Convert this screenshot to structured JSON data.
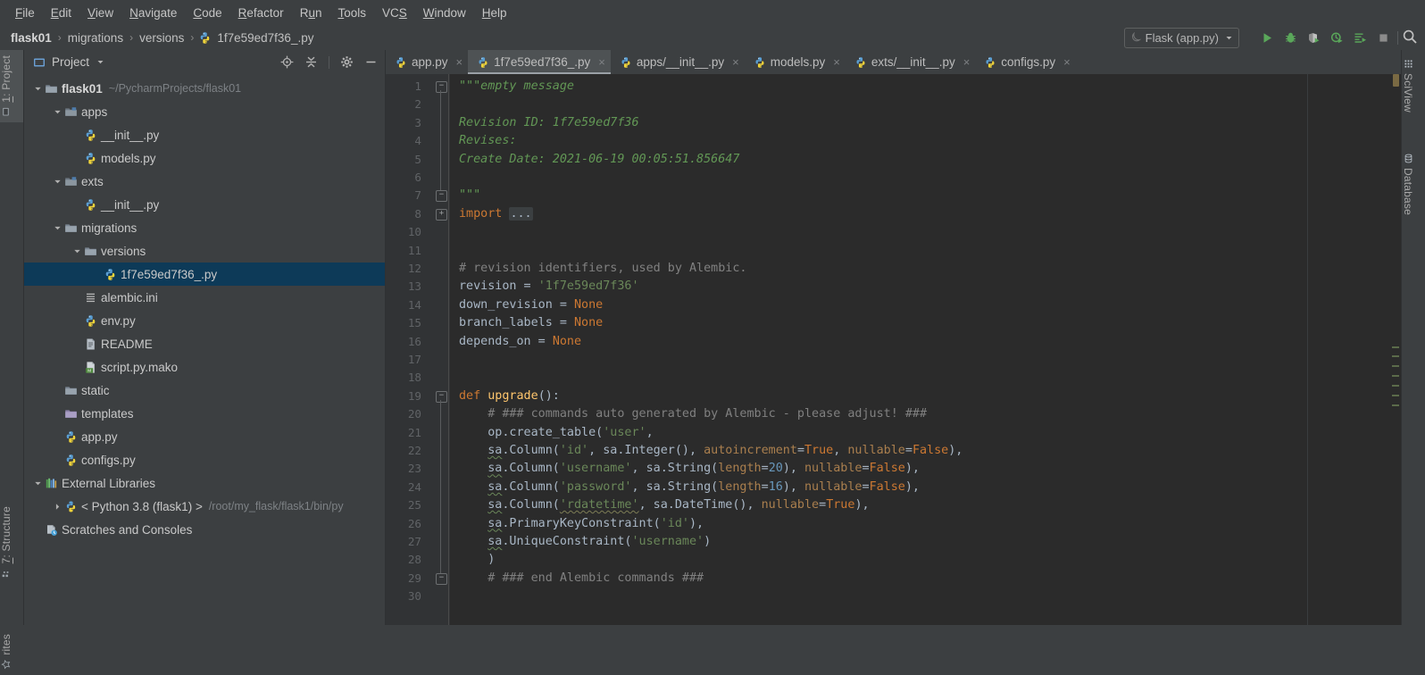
{
  "window": {
    "theme_bg": "#3c3f41",
    "editor_bg": "#2b2b2b",
    "accent_selection": "#0d3a58"
  },
  "menubar": {
    "items": [
      {
        "label": "File",
        "mnemonic": "F"
      },
      {
        "label": "Edit",
        "mnemonic": "E"
      },
      {
        "label": "View",
        "mnemonic": "V"
      },
      {
        "label": "Navigate",
        "mnemonic": "N"
      },
      {
        "label": "Code",
        "mnemonic": "C"
      },
      {
        "label": "Refactor",
        "mnemonic": "R"
      },
      {
        "label": "Run",
        "mnemonic": "u"
      },
      {
        "label": "Tools",
        "mnemonic": "T"
      },
      {
        "label": "VCS",
        "mnemonic": "S"
      },
      {
        "label": "Window",
        "mnemonic": "W"
      },
      {
        "label": "Help",
        "mnemonic": "H"
      }
    ]
  },
  "navbar": {
    "breadcrumb": [
      "flask01",
      "migrations",
      "versions",
      "1f7e59ed7f36_.py"
    ],
    "run_config": {
      "name": "Flask (app.py)",
      "icon": "flask-config-icon",
      "dropdown": "chevron-down-icon"
    },
    "toolbar_icons": [
      "run-icon",
      "debug-icon",
      "run-coverage-icon",
      "profile-icon",
      "run-with-console-icon",
      "stop-icon"
    ],
    "search_icon": "search-icon"
  },
  "left_rail": {
    "tabs": [
      {
        "label": "1: Project",
        "num": "1",
        "icon": "project-tool-icon",
        "selected": true
      },
      {
        "label": "7: Structure",
        "num": "7",
        "icon": "structure-tool-icon",
        "selected": false
      },
      {
        "label": "rites",
        "num": "",
        "icon": "favorites-tool-icon",
        "selected": false
      }
    ]
  },
  "right_rail": {
    "tabs": [
      {
        "label": "SciView",
        "icon": "sciview-icon"
      },
      {
        "label": "Database",
        "icon": "database-icon"
      }
    ]
  },
  "project_panel": {
    "title": "Project",
    "dropdown_icon": "chevron-down-icon",
    "header_icons": [
      "locate-target-icon",
      "collapse-all-icon",
      "settings-gear-icon",
      "hide-panel-icon"
    ],
    "tree": [
      {
        "indent": 0,
        "arrow": "down",
        "icon": "folder-project",
        "name": "flask01",
        "bold": true,
        "sub": "~/PycharmProjects/flask01",
        "selected": false
      },
      {
        "indent": 1,
        "arrow": "down",
        "icon": "folder-module",
        "name": "apps",
        "bold": false,
        "sub": "",
        "selected": false
      },
      {
        "indent": 2,
        "arrow": "none",
        "icon": "python-file",
        "name": "__init__.py",
        "bold": false,
        "sub": "",
        "selected": false
      },
      {
        "indent": 2,
        "arrow": "none",
        "icon": "python-file",
        "name": "models.py",
        "bold": false,
        "sub": "",
        "selected": false
      },
      {
        "indent": 1,
        "arrow": "down",
        "icon": "folder-module",
        "name": "exts",
        "bold": false,
        "sub": "",
        "selected": false
      },
      {
        "indent": 2,
        "arrow": "none",
        "icon": "python-file",
        "name": "__init__.py",
        "bold": false,
        "sub": "",
        "selected": false
      },
      {
        "indent": 1,
        "arrow": "down",
        "icon": "folder",
        "name": "migrations",
        "bold": false,
        "sub": "",
        "selected": false
      },
      {
        "indent": 2,
        "arrow": "down",
        "icon": "folder",
        "name": "versions",
        "bold": false,
        "sub": "",
        "selected": false
      },
      {
        "indent": 3,
        "arrow": "none",
        "icon": "python-file",
        "name": "1f7e59ed7f36_.py",
        "bold": false,
        "sub": "",
        "selected": true
      },
      {
        "indent": 2,
        "arrow": "none",
        "icon": "ini-file",
        "name": "alembic.ini",
        "bold": false,
        "sub": "",
        "selected": false
      },
      {
        "indent": 2,
        "arrow": "none",
        "icon": "python-file",
        "name": "env.py",
        "bold": false,
        "sub": "",
        "selected": false
      },
      {
        "indent": 2,
        "arrow": "none",
        "icon": "text-file",
        "name": "README",
        "bold": false,
        "sub": "",
        "selected": false
      },
      {
        "indent": 2,
        "arrow": "none",
        "icon": "mako-file",
        "name": "script.py.mako",
        "bold": false,
        "sub": "",
        "selected": false
      },
      {
        "indent": 1,
        "arrow": "none",
        "icon": "folder",
        "name": "static",
        "bold": false,
        "sub": "",
        "selected": false
      },
      {
        "indent": 1,
        "arrow": "none",
        "icon": "folder-templates",
        "name": "templates",
        "bold": false,
        "sub": "",
        "selected": false
      },
      {
        "indent": 1,
        "arrow": "none",
        "icon": "python-file",
        "name": "app.py",
        "bold": false,
        "sub": "",
        "selected": false
      },
      {
        "indent": 1,
        "arrow": "none",
        "icon": "python-file",
        "name": "configs.py",
        "bold": false,
        "sub": "",
        "selected": false
      },
      {
        "indent": 0,
        "arrow": "down",
        "icon": "external-libraries",
        "name": "External Libraries",
        "bold": false,
        "sub": "",
        "selected": false
      },
      {
        "indent": 1,
        "arrow": "right",
        "icon": "python-sdk",
        "name": "< Python 3.8 (flask1) >",
        "bold": false,
        "sub": "/root/my_flask/flask1/bin/py",
        "selected": false
      },
      {
        "indent": 0,
        "arrow": "none",
        "icon": "scratches",
        "name": "Scratches and Consoles",
        "bold": false,
        "sub": "",
        "selected": false
      }
    ]
  },
  "editor_tabs": [
    {
      "label": "app.py",
      "icon": "python-file",
      "active": false,
      "closable": true
    },
    {
      "label": "1f7e59ed7f36_.py",
      "icon": "python-file",
      "active": true,
      "closable": true
    },
    {
      "label": "apps/__init__.py",
      "icon": "python-file",
      "active": false,
      "closable": true
    },
    {
      "label": "models.py",
      "icon": "python-file",
      "active": false,
      "closable": true
    },
    {
      "label": "exts/__init__.py",
      "icon": "python-file",
      "active": false,
      "closable": true
    },
    {
      "label": "configs.py",
      "icon": "python-file",
      "active": false,
      "closable": true
    }
  ],
  "editor": {
    "filename": "1f7e59ed7f36_.py",
    "line_numbers": [
      1,
      2,
      3,
      4,
      5,
      6,
      7,
      8,
      10,
      11,
      12,
      13,
      14,
      15,
      16,
      17,
      18,
      19,
      20,
      21,
      22,
      23,
      24,
      25,
      26,
      27,
      28,
      29,
      30
    ],
    "lines": [
      {
        "n": 1,
        "html": "<span class=\"t-doc\">\"\"\"empty message</span>"
      },
      {
        "n": 2,
        "html": ""
      },
      {
        "n": 3,
        "html": "<span class=\"t-doc\">Revision ID: 1f7e59ed7f36</span>"
      },
      {
        "n": 4,
        "html": "<span class=\"t-doc\">Revises: </span>"
      },
      {
        "n": 5,
        "html": "<span class=\"t-doc\">Create Date: 2021-06-19 00:05:51.856647</span>"
      },
      {
        "n": 6,
        "html": ""
      },
      {
        "n": 7,
        "html": "<span class=\"t-doc\">\"\"\"</span>"
      },
      {
        "n": 8,
        "html": "<span class=\"t-kw\">import</span> <span class=\"t-fold\">...</span>"
      },
      {
        "n": 10,
        "html": ""
      },
      {
        "n": 11,
        "html": ""
      },
      {
        "n": 12,
        "html": "<span class=\"t-cmt\"># revision identifiers, used by Alembic.</span>"
      },
      {
        "n": 13,
        "html": "revision = <span class=\"t-str\">'1f7e59ed7f36'</span>"
      },
      {
        "n": 14,
        "html": "down_revision = <span class=\"t-kw\">None</span>"
      },
      {
        "n": 15,
        "html": "branch_labels = <span class=\"t-kw\">None</span>"
      },
      {
        "n": 16,
        "html": "depends_on = <span class=\"t-kw\">None</span>"
      },
      {
        "n": 17,
        "html": ""
      },
      {
        "n": 18,
        "html": ""
      },
      {
        "n": 19,
        "html": "<span class=\"t-kw\">def</span> <span class=\"t-def\">upgrade</span>():"
      },
      {
        "n": 20,
        "html": "    <span class=\"t-cmt\"># ### commands auto generated by Alembic - please adjust! ###</span>"
      },
      {
        "n": 21,
        "html": "    op.create_table(<span class=\"t-str\">'user'</span>,"
      },
      {
        "n": 22,
        "html": "    <span class=\"sq\">sa</span>.Column(<span class=\"t-str\">'id'</span>, sa.Integer(), <span class=\"t-kwarg\">autoincrement</span>=<span class=\"t-kw\">True</span>, <span class=\"t-kwarg\">nullable</span>=<span class=\"t-kw\">False</span>),"
      },
      {
        "n": 23,
        "html": "    <span class=\"sq\">sa</span>.Column(<span class=\"t-str\">'username'</span>, sa.String(<span class=\"t-kwarg\">length</span>=<span class=\"t-num\">20</span>), <span class=\"t-kwarg\">nullable</span>=<span class=\"t-kw\">False</span>),"
      },
      {
        "n": 24,
        "html": "    <span class=\"sq\">sa</span>.Column(<span class=\"t-str\">'password'</span>, sa.String(<span class=\"t-kwarg\">length</span>=<span class=\"t-num\">16</span>), <span class=\"t-kwarg\">nullable</span>=<span class=\"t-kw\">False</span>),"
      },
      {
        "n": 25,
        "html": "    <span class=\"sq\">sa</span>.Column(<span class=\"t-str sqw\">'rdatetime'</span>, sa.DateTime(), <span class=\"t-kwarg\">nullable</span>=<span class=\"t-kw\">True</span>),"
      },
      {
        "n": 26,
        "html": "    <span class=\"sq\">sa</span>.PrimaryKeyConstraint(<span class=\"t-str\">'id'</span>),"
      },
      {
        "n": 27,
        "html": "    <span class=\"sq\">sa</span>.UniqueConstraint(<span class=\"t-str\">'username'</span>)"
      },
      {
        "n": 28,
        "html": "    )"
      },
      {
        "n": 29,
        "html": "    <span class=\"t-cmt\"># ### end Alembic commands ###</span>"
      },
      {
        "n": 30,
        "html": ""
      }
    ],
    "plain_text": [
      "\"\"\"empty message",
      "",
      "Revision ID: 1f7e59ed7f36",
      "Revises: ",
      "Create Date: 2021-06-19 00:05:51.856647",
      "",
      "\"\"\"",
      "import ...",
      "",
      "",
      "# revision identifiers, used by Alembic.",
      "revision = '1f7e59ed7f36'",
      "down_revision = None",
      "branch_labels = None",
      "depends_on = None",
      "",
      "",
      "def upgrade():",
      "    # ### commands auto generated by Alembic - please adjust! ###",
      "    op.create_table('user',",
      "    sa.Column('id', sa.Integer(), autoincrement=True, nullable=False),",
      "    sa.Column('username', sa.String(length=20), nullable=False),",
      "    sa.Column('password', sa.String(length=16), nullable=False),",
      "    sa.Column('rdatetime', sa.DateTime(), nullable=True),",
      "    sa.PrimaryKeyConstraint('id'),",
      "    sa.UniqueConstraint('username')",
      "    )",
      "    # ### end Alembic commands ###",
      ""
    ]
  }
}
